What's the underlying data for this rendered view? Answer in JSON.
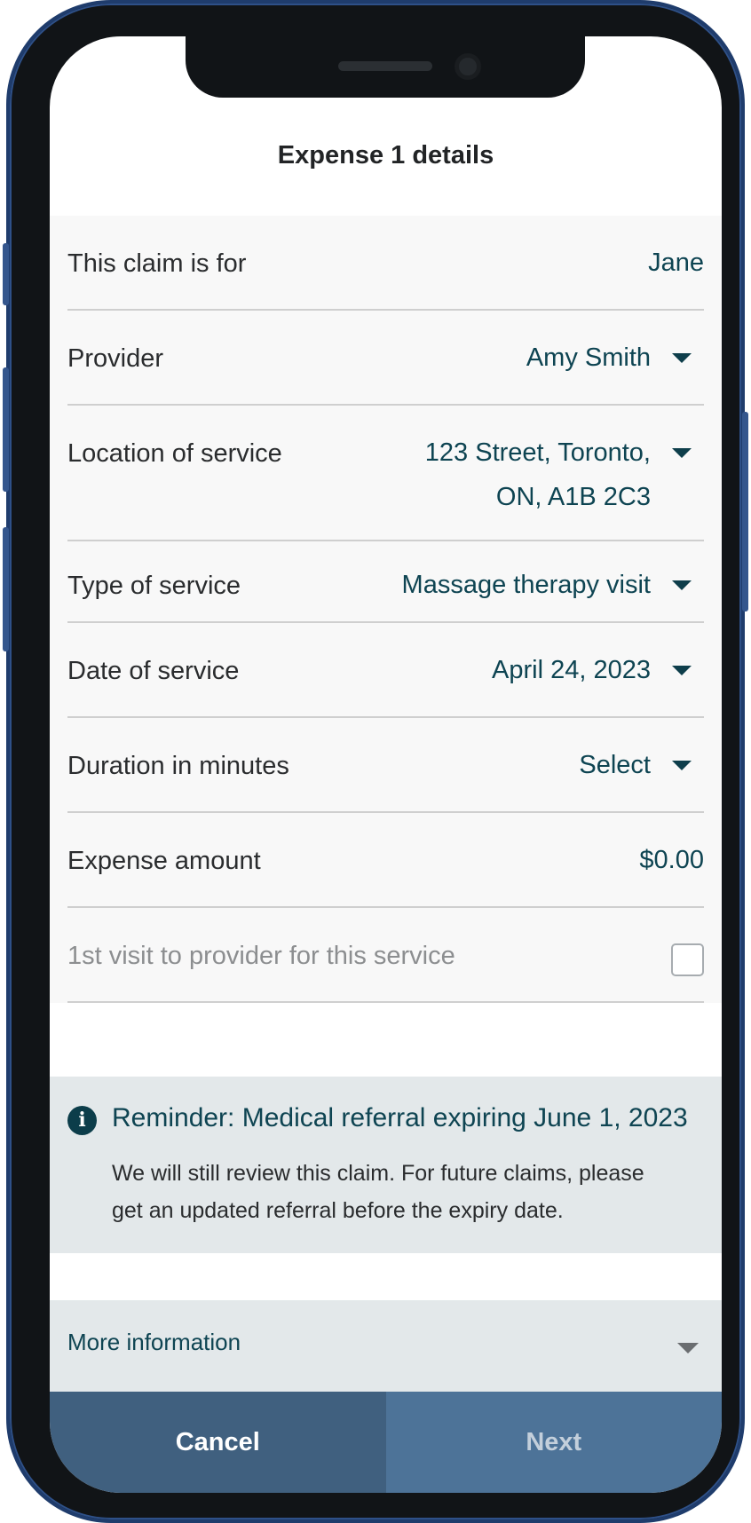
{
  "header": {
    "title": "Expense 1 details"
  },
  "form": {
    "claim_for": {
      "label": "This claim is for",
      "value": "Jane"
    },
    "provider": {
      "label": "Provider",
      "value": "Amy Smith"
    },
    "location": {
      "label": "Location of service",
      "value_line1": "123 Street, Toronto,",
      "value_line2": "ON, A1B 2C3"
    },
    "service_type": {
      "label": "Type of service",
      "value": "Massage therapy visit"
    },
    "service_date": {
      "label": "Date of service",
      "value": "April 24, 2023"
    },
    "duration": {
      "label": "Duration in minutes",
      "value": "Select"
    },
    "amount": {
      "label": "Expense amount",
      "value": "$0.00"
    },
    "first_visit": {
      "label": "1st visit to provider for this service",
      "checked": false
    }
  },
  "reminder": {
    "icon": "info-icon",
    "title": "Reminder: Medical referral expiring June 1, 2023",
    "body": "We will still review this claim. For future claims, please get an updated referral before the expiry date."
  },
  "more_info": {
    "label": "More information"
  },
  "footer": {
    "cancel_label": "Cancel",
    "next_label": "Next"
  },
  "colors": {
    "accent": "#0e4452",
    "cancel_bg": "#40607f",
    "next_bg": "#4d7398",
    "frame": "#1f3c6c"
  }
}
